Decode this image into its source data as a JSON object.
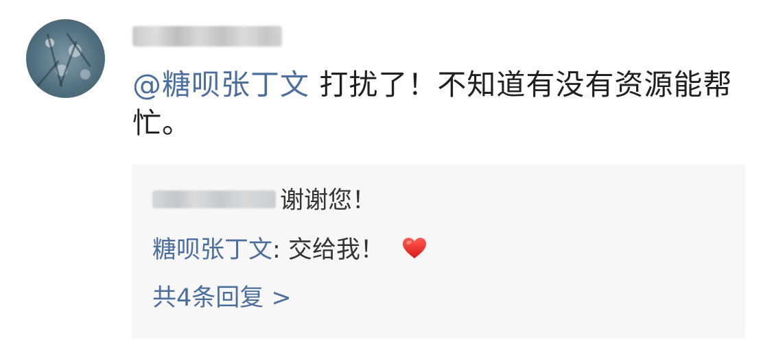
{
  "comment": {
    "mention": "@糖呗张丁文",
    "text": " 打扰了！不知道有没有资源能帮忙。"
  },
  "replies": [
    {
      "text": "谢谢您！"
    },
    {
      "name": "糖呗张丁文",
      "text": ": 交给我！"
    }
  ],
  "more_replies": "共4条回复 >",
  "colors": {
    "link": "#4a6f9f",
    "text": "#1f1f1f",
    "reply_bg": "#f7f7f7",
    "heart": "#e53935"
  },
  "icons": {
    "heart": "heart-icon"
  }
}
